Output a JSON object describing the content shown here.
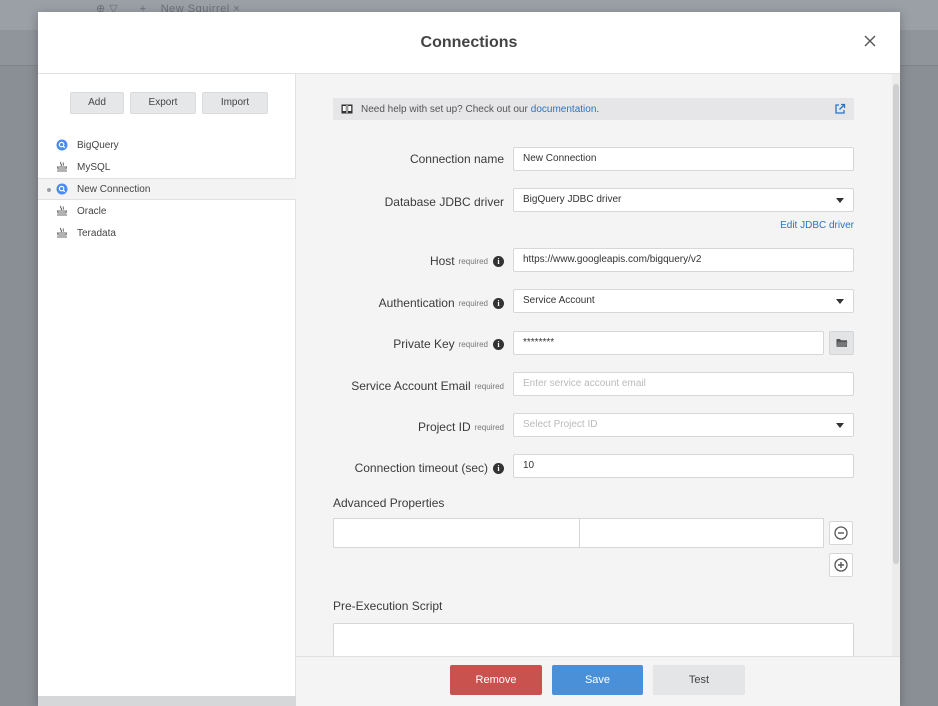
{
  "background": {
    "tab_text": "New Squirrel"
  },
  "modal": {
    "title": "Connections"
  },
  "sidebar": {
    "buttons": {
      "add": "Add",
      "export": "Export",
      "import": "Import"
    },
    "items": [
      {
        "label": "BigQuery",
        "icon": "bigquery-icon",
        "active": false
      },
      {
        "label": "MySQL",
        "icon": "database-icon",
        "active": false
      },
      {
        "label": "New Connection",
        "icon": "bigquery-icon",
        "active": true
      },
      {
        "label": "Oracle",
        "icon": "database-icon",
        "active": false
      },
      {
        "label": "Teradata",
        "icon": "database-icon",
        "active": false
      }
    ]
  },
  "help": {
    "text": "Need help with set up? Check out our",
    "link": "documentation",
    "suffix": "."
  },
  "form": {
    "connection_name": {
      "label": "Connection name",
      "value": "New Connection"
    },
    "driver": {
      "label": "Database JDBC driver",
      "value": "BigQuery JDBC driver",
      "edit_link": "Edit JDBC driver"
    },
    "host": {
      "label": "Host",
      "required": "required",
      "value": "https://www.googleapis.com/bigquery/v2"
    },
    "authentication": {
      "label": "Authentication",
      "required": "required",
      "value": "Service Account"
    },
    "private_key": {
      "label": "Private Key",
      "required": "required",
      "value": "********"
    },
    "service_email": {
      "label": "Service Account Email",
      "required": "required",
      "placeholder": "Enter service account email"
    },
    "project_id": {
      "label": "Project ID",
      "required": "required",
      "placeholder": "Select Project ID"
    },
    "timeout": {
      "label": "Connection timeout (sec)",
      "value": "10"
    },
    "advanced_title": "Advanced Properties",
    "script_title": "Pre-Execution Script"
  },
  "footer": {
    "remove": "Remove",
    "save": "Save",
    "test": "Test"
  },
  "colors": {
    "accent": "#4a90d9",
    "danger": "#c9524f",
    "link": "#2a74c4"
  }
}
